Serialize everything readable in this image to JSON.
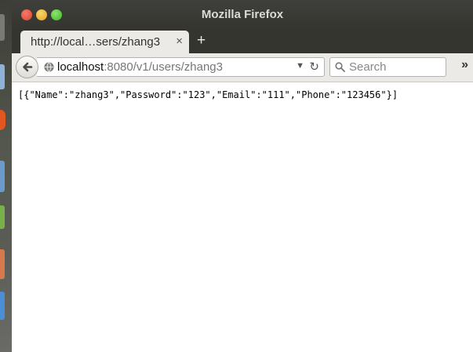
{
  "window": {
    "title": "Mozilla Firefox"
  },
  "tabs": [
    {
      "label": "http://local…sers/zhang3",
      "close_glyph": "×"
    }
  ],
  "new_tab_glyph": "+",
  "urlbar": {
    "host": "localhost",
    "rest": ":8080/v1/users/zhang3",
    "dropdown_glyph": "▼",
    "reload_glyph": "↻"
  },
  "search": {
    "placeholder": "Search"
  },
  "overflow_glyph": "»",
  "content": {
    "body_text": "[{\"Name\":\"zhang3\",\"Password\":\"123\",\"Email\":\"111\",\"Phone\":\"123456\"}]"
  },
  "icons": {
    "back": "back-arrow-icon",
    "site": "globe-icon",
    "search": "magnifier-icon"
  },
  "colors": {
    "titlebar": "#3c3b37",
    "chrome": "#eceae6",
    "close": "#e0432d",
    "minimize": "#e8a424",
    "maximize": "#3fb52b"
  }
}
